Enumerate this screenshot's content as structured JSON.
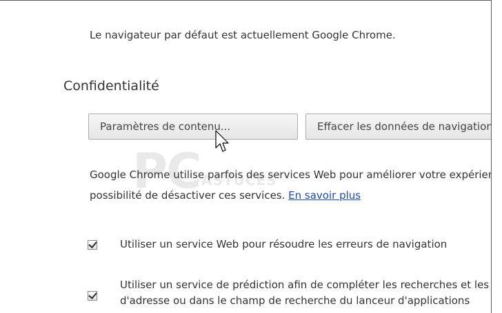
{
  "settings": {
    "default_browser_text": "Le navigateur par défaut est actuellement Google Chrome.",
    "privacy": {
      "title": "Confidentialité",
      "content_settings_button": "Paramètres de contenu...",
      "clear_data_button": "Effacer les données de navigation...",
      "description_line1": "Google Chrome utilise parfois des services Web pour améliorer votre expérience de navigation. Vous avez la",
      "description_line2": "possibilité de désactiver ces services.",
      "learn_more_link": "En savoir plus",
      "options": [
        {
          "label": "Utiliser un service Web pour résoudre les erreurs de navigation",
          "checked": true
        },
        {
          "label_line1": "Utiliser un service de prédiction afin de compléter les recherches et les URL saisies dans la barre",
          "label_line2": "d'adresse ou dans le champ de recherche du lanceur d'applications",
          "checked": true
        }
      ]
    }
  },
  "watermark": {
    "big": "PC",
    "small": "ASTUCES"
  },
  "colors": {
    "link": "#1a4bb0",
    "text": "#333333",
    "button_border": "#acacac"
  }
}
